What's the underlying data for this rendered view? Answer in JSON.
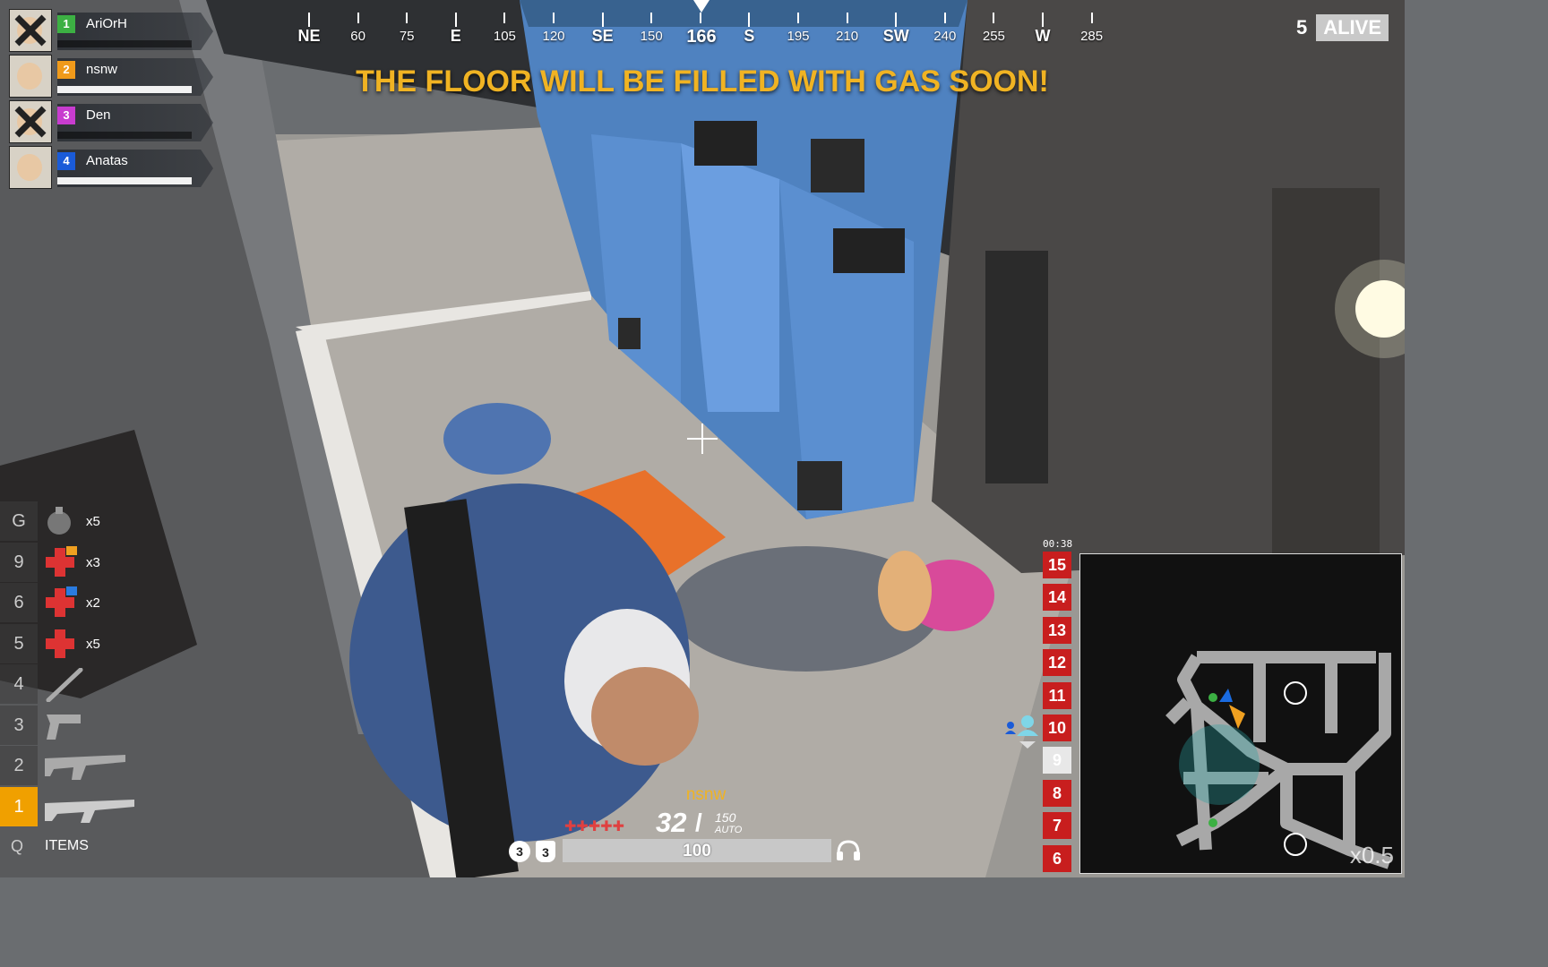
{
  "team": [
    {
      "slot": "1",
      "name": "AriOrH",
      "color": "#3cb043",
      "dead": true,
      "hp_fraction": 0.0
    },
    {
      "slot": "2",
      "name": "nsnw",
      "color": "#f09a1a",
      "dead": false,
      "hp_fraction": 1.0
    },
    {
      "slot": "3",
      "name": "Den",
      "color": "#c83ccf",
      "dead": true,
      "hp_fraction": 0.0
    },
    {
      "slot": "4",
      "name": "Anatas",
      "color": "#1a5bd8",
      "dead": false,
      "hp_fraction": 1.0
    }
  ],
  "compass": {
    "heading": "166",
    "marks": [
      "NE",
      "60",
      "75",
      "E",
      "105",
      "120",
      "SE",
      "150",
      "165",
      "S",
      "195",
      "210",
      "SW",
      "240",
      "255",
      "W",
      "285"
    ],
    "cardinals": [
      "NE",
      "E",
      "SE",
      "S",
      "SW",
      "W"
    ]
  },
  "alert": "THE FLOOR WILL BE FILLED WITH GAS SOON!",
  "alive": {
    "count": "5",
    "label": "ALIVE"
  },
  "inventory": {
    "slots": [
      {
        "key": "G",
        "icon": "grenade-icon",
        "count": "x5"
      },
      {
        "key": "9",
        "icon": "medkit-icon",
        "count": "x3"
      },
      {
        "key": "6",
        "icon": "bandage-icon",
        "count": "x2"
      },
      {
        "key": "5",
        "icon": "first-aid-icon",
        "count": "x5"
      },
      {
        "key": "4",
        "icon": "bat-icon",
        "count": ""
      },
      {
        "key": "3",
        "icon": "pistol-icon",
        "count": ""
      },
      {
        "key": "2",
        "icon": "smg-icon",
        "count": ""
      },
      {
        "key": "1",
        "icon": "rifle-icon",
        "count": "",
        "active": true
      }
    ],
    "items_key": "Q",
    "items_label": "ITEMS"
  },
  "hud": {
    "player_name": "nsnw",
    "armor_marks": "✚✚✚✚✚",
    "ammo_loaded": "32",
    "ammo_reserve": "150",
    "fire_mode": "AUTO",
    "level_a": "3",
    "level_b": "3",
    "health": "100",
    "health_fraction": 1.0
  },
  "floors": {
    "timer": "00:38",
    "levels": [
      "15",
      "14",
      "13",
      "12",
      "11",
      "10",
      "9",
      "8",
      "7",
      "6"
    ],
    "current": "9",
    "you_here": "10"
  },
  "minimap": {
    "zoom": "x0.5"
  },
  "colors": {
    "alert": "#f0b323",
    "floor": "#c81e1e",
    "active_slot": "#f0a000"
  }
}
